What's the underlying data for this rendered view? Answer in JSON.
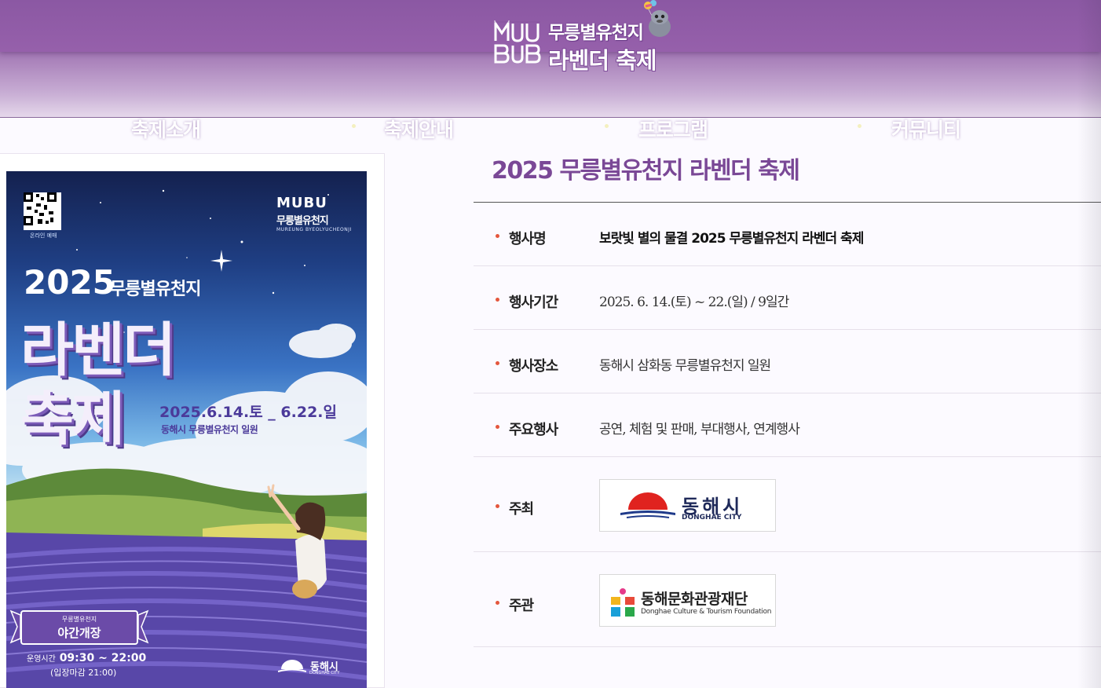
{
  "header": {
    "logo_mark": "MUBU",
    "logo_title_1": "무릉별유천지",
    "logo_title_2": "라벤더 축제"
  },
  "nav": {
    "items": [
      {
        "label": "축제소개"
      },
      {
        "label": "축제안내"
      },
      {
        "label": "프로그램"
      },
      {
        "label": "커뮤니티"
      }
    ]
  },
  "poster": {
    "qr_label": "온라인 예매",
    "brand": "MUBU",
    "brand_kr": "무릉별유천지",
    "brand_en": "MUREUNG BYEOLYUCHEONJI",
    "year": "2025",
    "place": "무릉별유천지",
    "title_1": "라벤더",
    "title_2": "축제",
    "dates": "2025.6.14.토 _ 6.22.일",
    "location": "동해시 무릉별유천지 일원",
    "night_sub": "무릉별유천지",
    "night_main": "야간개장",
    "hours": "09:30 ~ 22:00",
    "hours_label": "운영시간",
    "last_entry": "(입장마감 21:00)",
    "city": "동해시",
    "city_en": "DONGHAE CITY"
  },
  "info": {
    "title": "2025 무릉별유천지 라벤더 축제",
    "rows": [
      {
        "label": "행사명",
        "value": "보랏빛 별의 물결 2025 무릉별유천지 라벤더 축제"
      },
      {
        "label": "행사기간",
        "value": "2025. 6. 14.(토) ~ 22.(일) / 9일간"
      },
      {
        "label": "행사장소",
        "value": "동해시 삼화동 무릉별유천지 일원"
      },
      {
        "label": "주요행사",
        "value": "공연, 체험 및 판매, 부대행사, 연계행사"
      },
      {
        "label": "주최",
        "logo_name": "동해시",
        "logo_en": "DONGHAE CITY"
      },
      {
        "label": "주관",
        "logo_name": "동해문화관광재단",
        "logo_en": "Donghae Culture & Tourism Foundation"
      }
    ]
  },
  "colors": {
    "header_purple": "#8e5ba6",
    "title_purple": "#7a4896",
    "bullet_red": "#e4563d",
    "donghae_red": "#e0231f",
    "donghae_navy": "#1f3a8a"
  }
}
